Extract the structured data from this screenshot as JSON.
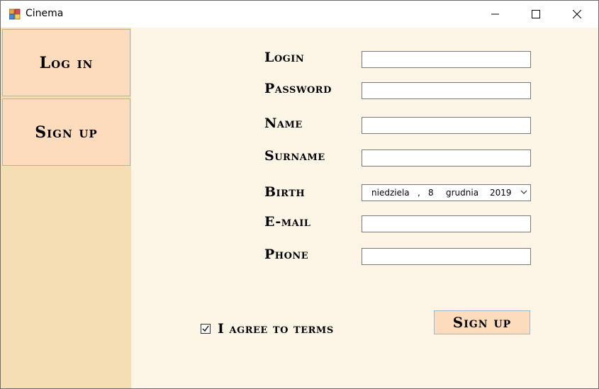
{
  "window": {
    "title": "Cinema",
    "icons": {
      "app": "app-icon",
      "minimize": "minimize-icon",
      "maximize": "maximize-icon",
      "close": "close-icon"
    }
  },
  "sidebar": {
    "items": [
      {
        "label": "Log in"
      },
      {
        "label": "Sign up"
      }
    ]
  },
  "form": {
    "labels": {
      "login": "Login",
      "password": "Password",
      "name": "Name",
      "surname": "Surname",
      "birth": "Birth",
      "email": "E-mail",
      "phone": "Phone"
    },
    "values": {
      "login": "",
      "password": "",
      "name": "",
      "surname": "",
      "email": "",
      "phone": ""
    },
    "birth_date": {
      "weekday": "niedziela",
      "separator": ",",
      "day": "8",
      "month": "grudnia",
      "year": "2019"
    },
    "terms": {
      "label": "I agree to terms",
      "checked": true
    },
    "submit_label": "Sign up"
  },
  "colors": {
    "sidebar_bg": "#f5deb3",
    "content_bg": "#fdf5e6",
    "button_bg": "#fddcbd",
    "button_border": "#9fb7cc"
  }
}
